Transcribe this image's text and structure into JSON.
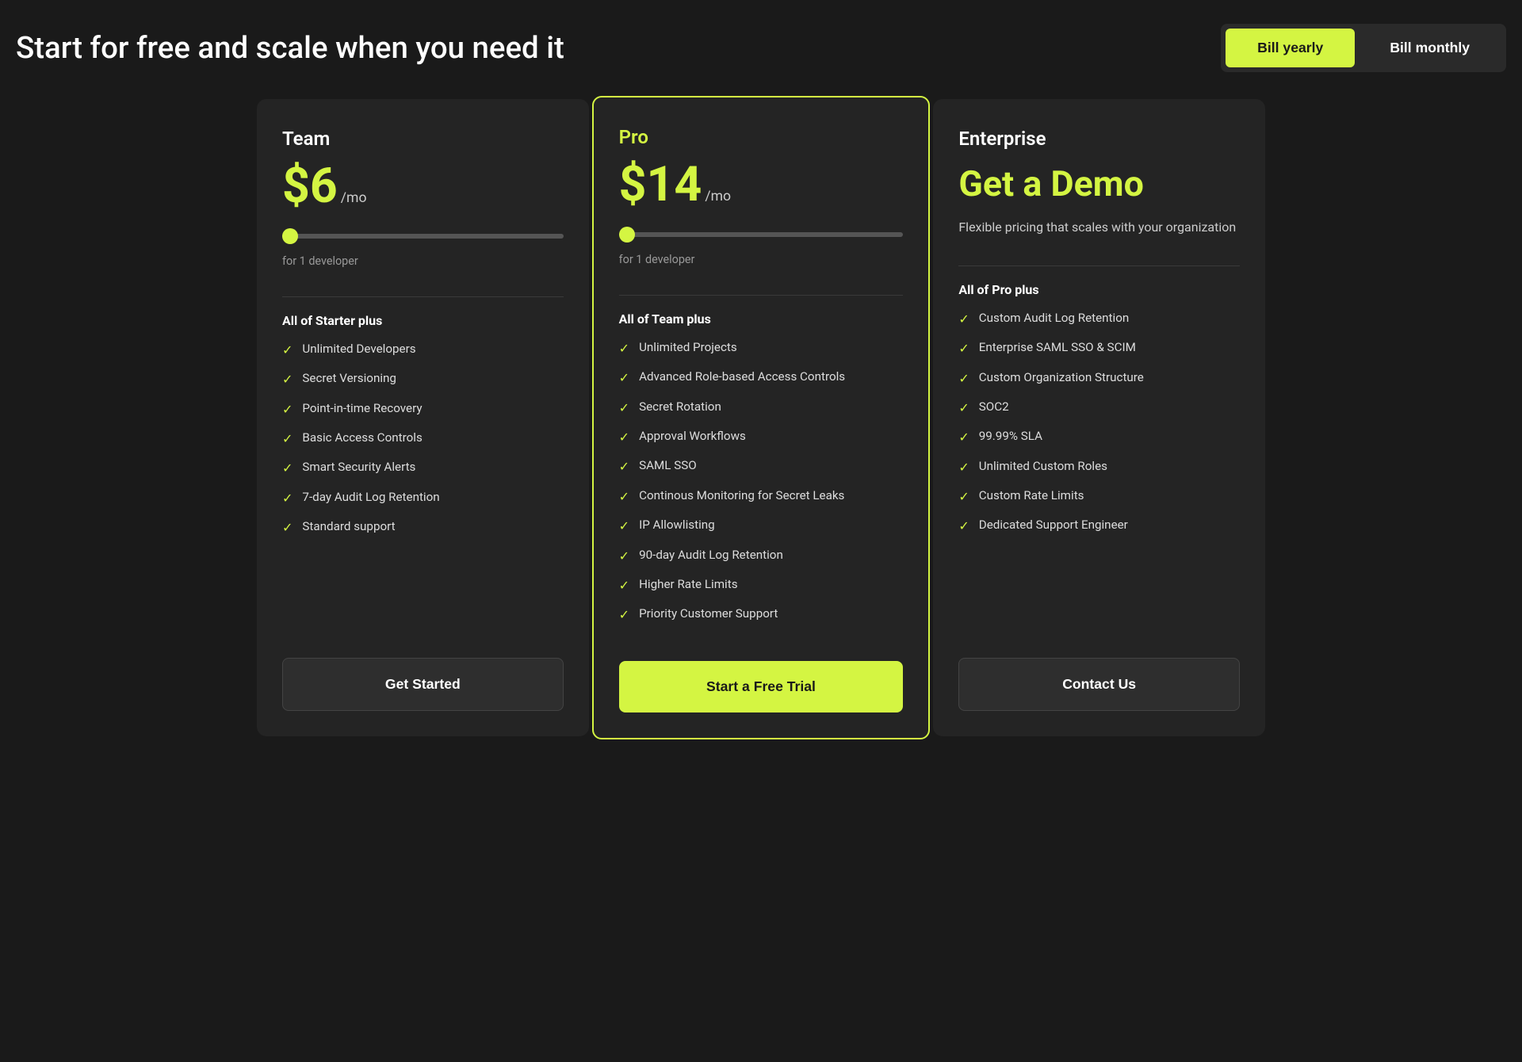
{
  "header": {
    "title": "Start for free and scale when you need it",
    "billing": {
      "yearly_label": "Bill yearly",
      "monthly_label": "Bill monthly",
      "active": "yearly"
    }
  },
  "plans": [
    {
      "id": "team",
      "name": "Team",
      "price": "$6",
      "price_period": "/mo",
      "slider_label": "for 1 developer",
      "features_heading": "All of Starter plus",
      "features": [
        "Unlimited Developers",
        "Secret Versioning",
        "Point-in-time Recovery",
        "Basic Access Controls",
        "Smart Security Alerts",
        "7-day Audit Log Retention",
        "Standard support"
      ],
      "cta_label": "Get Started",
      "cta_type": "secondary",
      "featured": false
    },
    {
      "id": "pro",
      "name": "Pro",
      "price": "$14",
      "price_period": "/mo",
      "slider_label": "for 1 developer",
      "features_heading": "All of Team plus",
      "features": [
        "Unlimited Projects",
        "Advanced Role-based Access Controls",
        "Secret Rotation",
        "Approval Workflows",
        "SAML SSO",
        "Continous Monitoring for Secret Leaks",
        "IP Allowlisting",
        "90-day Audit Log Retention",
        "Higher Rate Limits",
        "Priority Customer Support"
      ],
      "cta_label": "Start a Free Trial",
      "cta_type": "primary",
      "featured": true
    },
    {
      "id": "enterprise",
      "name": "Enterprise",
      "demo_label": "Get a Demo",
      "description": "Flexible pricing that scales with your organization",
      "features_heading": "All of Pro plus",
      "features": [
        "Custom Audit Log Retention",
        "Enterprise SAML SSO & SCIM",
        "Custom Organization Structure",
        "SOC2",
        "99.99% SLA",
        "Unlimited Custom Roles",
        "Custom Rate Limits",
        "Dedicated Support Engineer"
      ],
      "cta_label": "Contact Us",
      "cta_type": "secondary",
      "featured": false
    }
  ]
}
